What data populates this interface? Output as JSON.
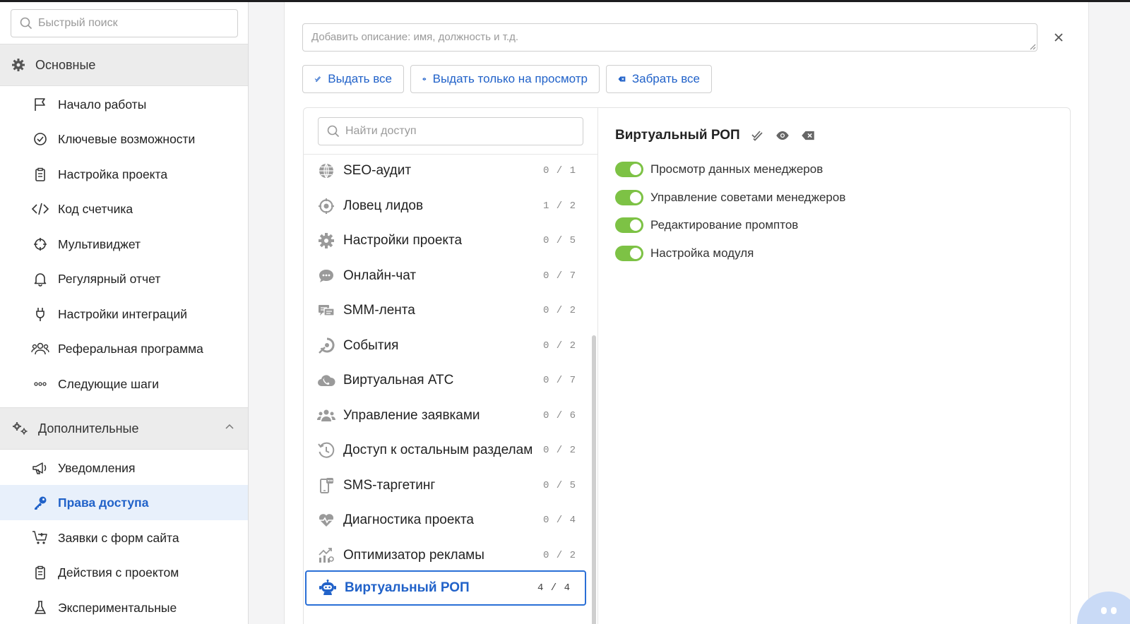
{
  "sidebar": {
    "search_placeholder": "Быстрый поиск",
    "sections": [
      {
        "label": "Основные",
        "items": [
          {
            "label": "Начало работы",
            "icon": "flag-icon"
          },
          {
            "label": "Ключевые возможности",
            "icon": "check-badge-icon"
          },
          {
            "label": "Настройка проекта",
            "icon": "clipboard-icon"
          },
          {
            "label": "Код счетчика",
            "icon": "code-icon"
          },
          {
            "label": "Мультивиджет",
            "icon": "crosshair-icon"
          },
          {
            "label": "Регулярный отчет",
            "icon": "bell-icon"
          },
          {
            "label": "Настройки интеграций",
            "icon": "plug-icon"
          },
          {
            "label": "Реферальная программа",
            "icon": "users-icon"
          },
          {
            "label": "Следующие шаги",
            "icon": "dots-icon"
          }
        ]
      },
      {
        "label": "Дополнительные",
        "items": [
          {
            "label": "Уведомления",
            "icon": "megaphone-icon"
          },
          {
            "label": "Права доступа",
            "icon": "key-icon",
            "active": true
          },
          {
            "label": "Заявки с форм сайта",
            "icon": "cart-icon"
          },
          {
            "label": "Действия с проектом",
            "icon": "clipboard-icon"
          },
          {
            "label": "Экспериментальные",
            "icon": "flask-icon"
          }
        ]
      }
    ]
  },
  "main": {
    "description_placeholder": "Добавить описание: имя, должность и т.д.",
    "actions": {
      "grant_all": "Выдать все",
      "view_only": "Выдать только на просмотр",
      "revoke_all": "Забрать все"
    },
    "access_search_placeholder": "Найти доступ",
    "access_items": [
      {
        "label": "SEO-аудит",
        "count": "0 / 1",
        "icon": "globe-icon"
      },
      {
        "label": "Ловец лидов",
        "count": "1 / 2",
        "icon": "target-icon"
      },
      {
        "label": "Настройки проекта",
        "count": "0 / 5",
        "icon": "gear-icon"
      },
      {
        "label": "Онлайн-чат",
        "count": "0 / 7",
        "icon": "chat-icon"
      },
      {
        "label": "SMM-лента",
        "count": "0 / 2",
        "icon": "feed-icon"
      },
      {
        "label": "События",
        "count": "0 / 2",
        "icon": "event-icon"
      },
      {
        "label": "Виртуальная АТС",
        "count": "0 / 7",
        "icon": "phone-cloud-icon"
      },
      {
        "label": "Управление заявками",
        "count": "0 / 6",
        "icon": "team-icon"
      },
      {
        "label": "Доступ к остальным разделам",
        "count": "0 / 2",
        "icon": "history-icon"
      },
      {
        "label": "SMS-таргетинг",
        "count": "0 / 5",
        "icon": "mobile-sms-icon"
      },
      {
        "label": "Диагностика проекта",
        "count": "0 / 4",
        "icon": "heart-pulse-icon"
      },
      {
        "label": "Оптимизатор рекламы",
        "count": "0 / 2",
        "icon": "chart-growth-icon"
      },
      {
        "label": "Виртуальный РОП",
        "count": "4 / 4",
        "icon": "robot-icon",
        "active": true
      }
    ],
    "detail": {
      "title": "Виртуальный РОП",
      "permissions": [
        {
          "label": "Просмотр данных менеджеров",
          "enabled": true
        },
        {
          "label": "Управление советами менеджеров",
          "enabled": true
        },
        {
          "label": "Редактирование промптов",
          "enabled": true
        },
        {
          "label": "Настройка модуля",
          "enabled": true
        }
      ]
    }
  },
  "colors": {
    "accent": "#2162c9",
    "toggle_on": "#7dc245",
    "active_bg": "#e8f0fb"
  }
}
